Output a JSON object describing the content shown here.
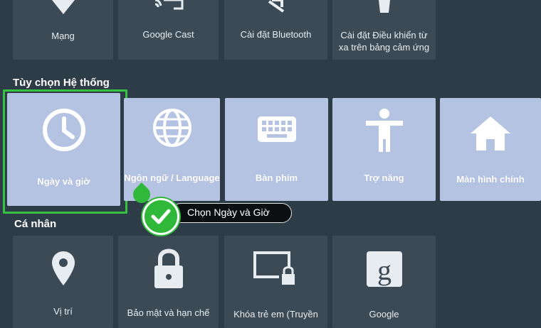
{
  "top_row": [
    {
      "label": "Mạng",
      "icon": "wifi-icon"
    },
    {
      "label": "Google Cast",
      "icon": "cast-icon"
    },
    {
      "label": "Cài đặt Bluetooth",
      "icon": "bluetooth-icon"
    },
    {
      "label_line1": "Cài đặt Điều khiển từ",
      "label_line2": "xa trên bảng cảm ứng",
      "icon": "remote-icon"
    }
  ],
  "system_section": {
    "title": "Tùy chọn Hệ thống",
    "tiles": [
      {
        "label": "Ngày và giờ",
        "icon": "clock-icon"
      },
      {
        "label": "Ngôn ngữ / Language",
        "icon": "globe-icon"
      },
      {
        "label": "Bàn phím",
        "icon": "keyboard-icon"
      },
      {
        "label": "Trợ năng",
        "icon": "accessibility-icon"
      },
      {
        "label": "Màn hình chính",
        "icon": "home-icon"
      }
    ]
  },
  "personal_section": {
    "title": "Cá nhân",
    "tiles": [
      {
        "label": "Vị trí",
        "icon": "location-pin-icon"
      },
      {
        "label": "Bảo mật và hạn chế",
        "icon": "lock-icon"
      },
      {
        "label": "Khóa trẻ em (Truyền",
        "icon": "parental-lock-icon"
      },
      {
        "label": "Google",
        "icon": "google-icon"
      }
    ]
  },
  "callout": {
    "text": "Chọn Ngày và Giờ"
  },
  "colors": {
    "background": "#2e3c47",
    "tile_dark": "#3c4a55",
    "tile_light": "#b5c3e2",
    "highlight": "#36c241"
  }
}
